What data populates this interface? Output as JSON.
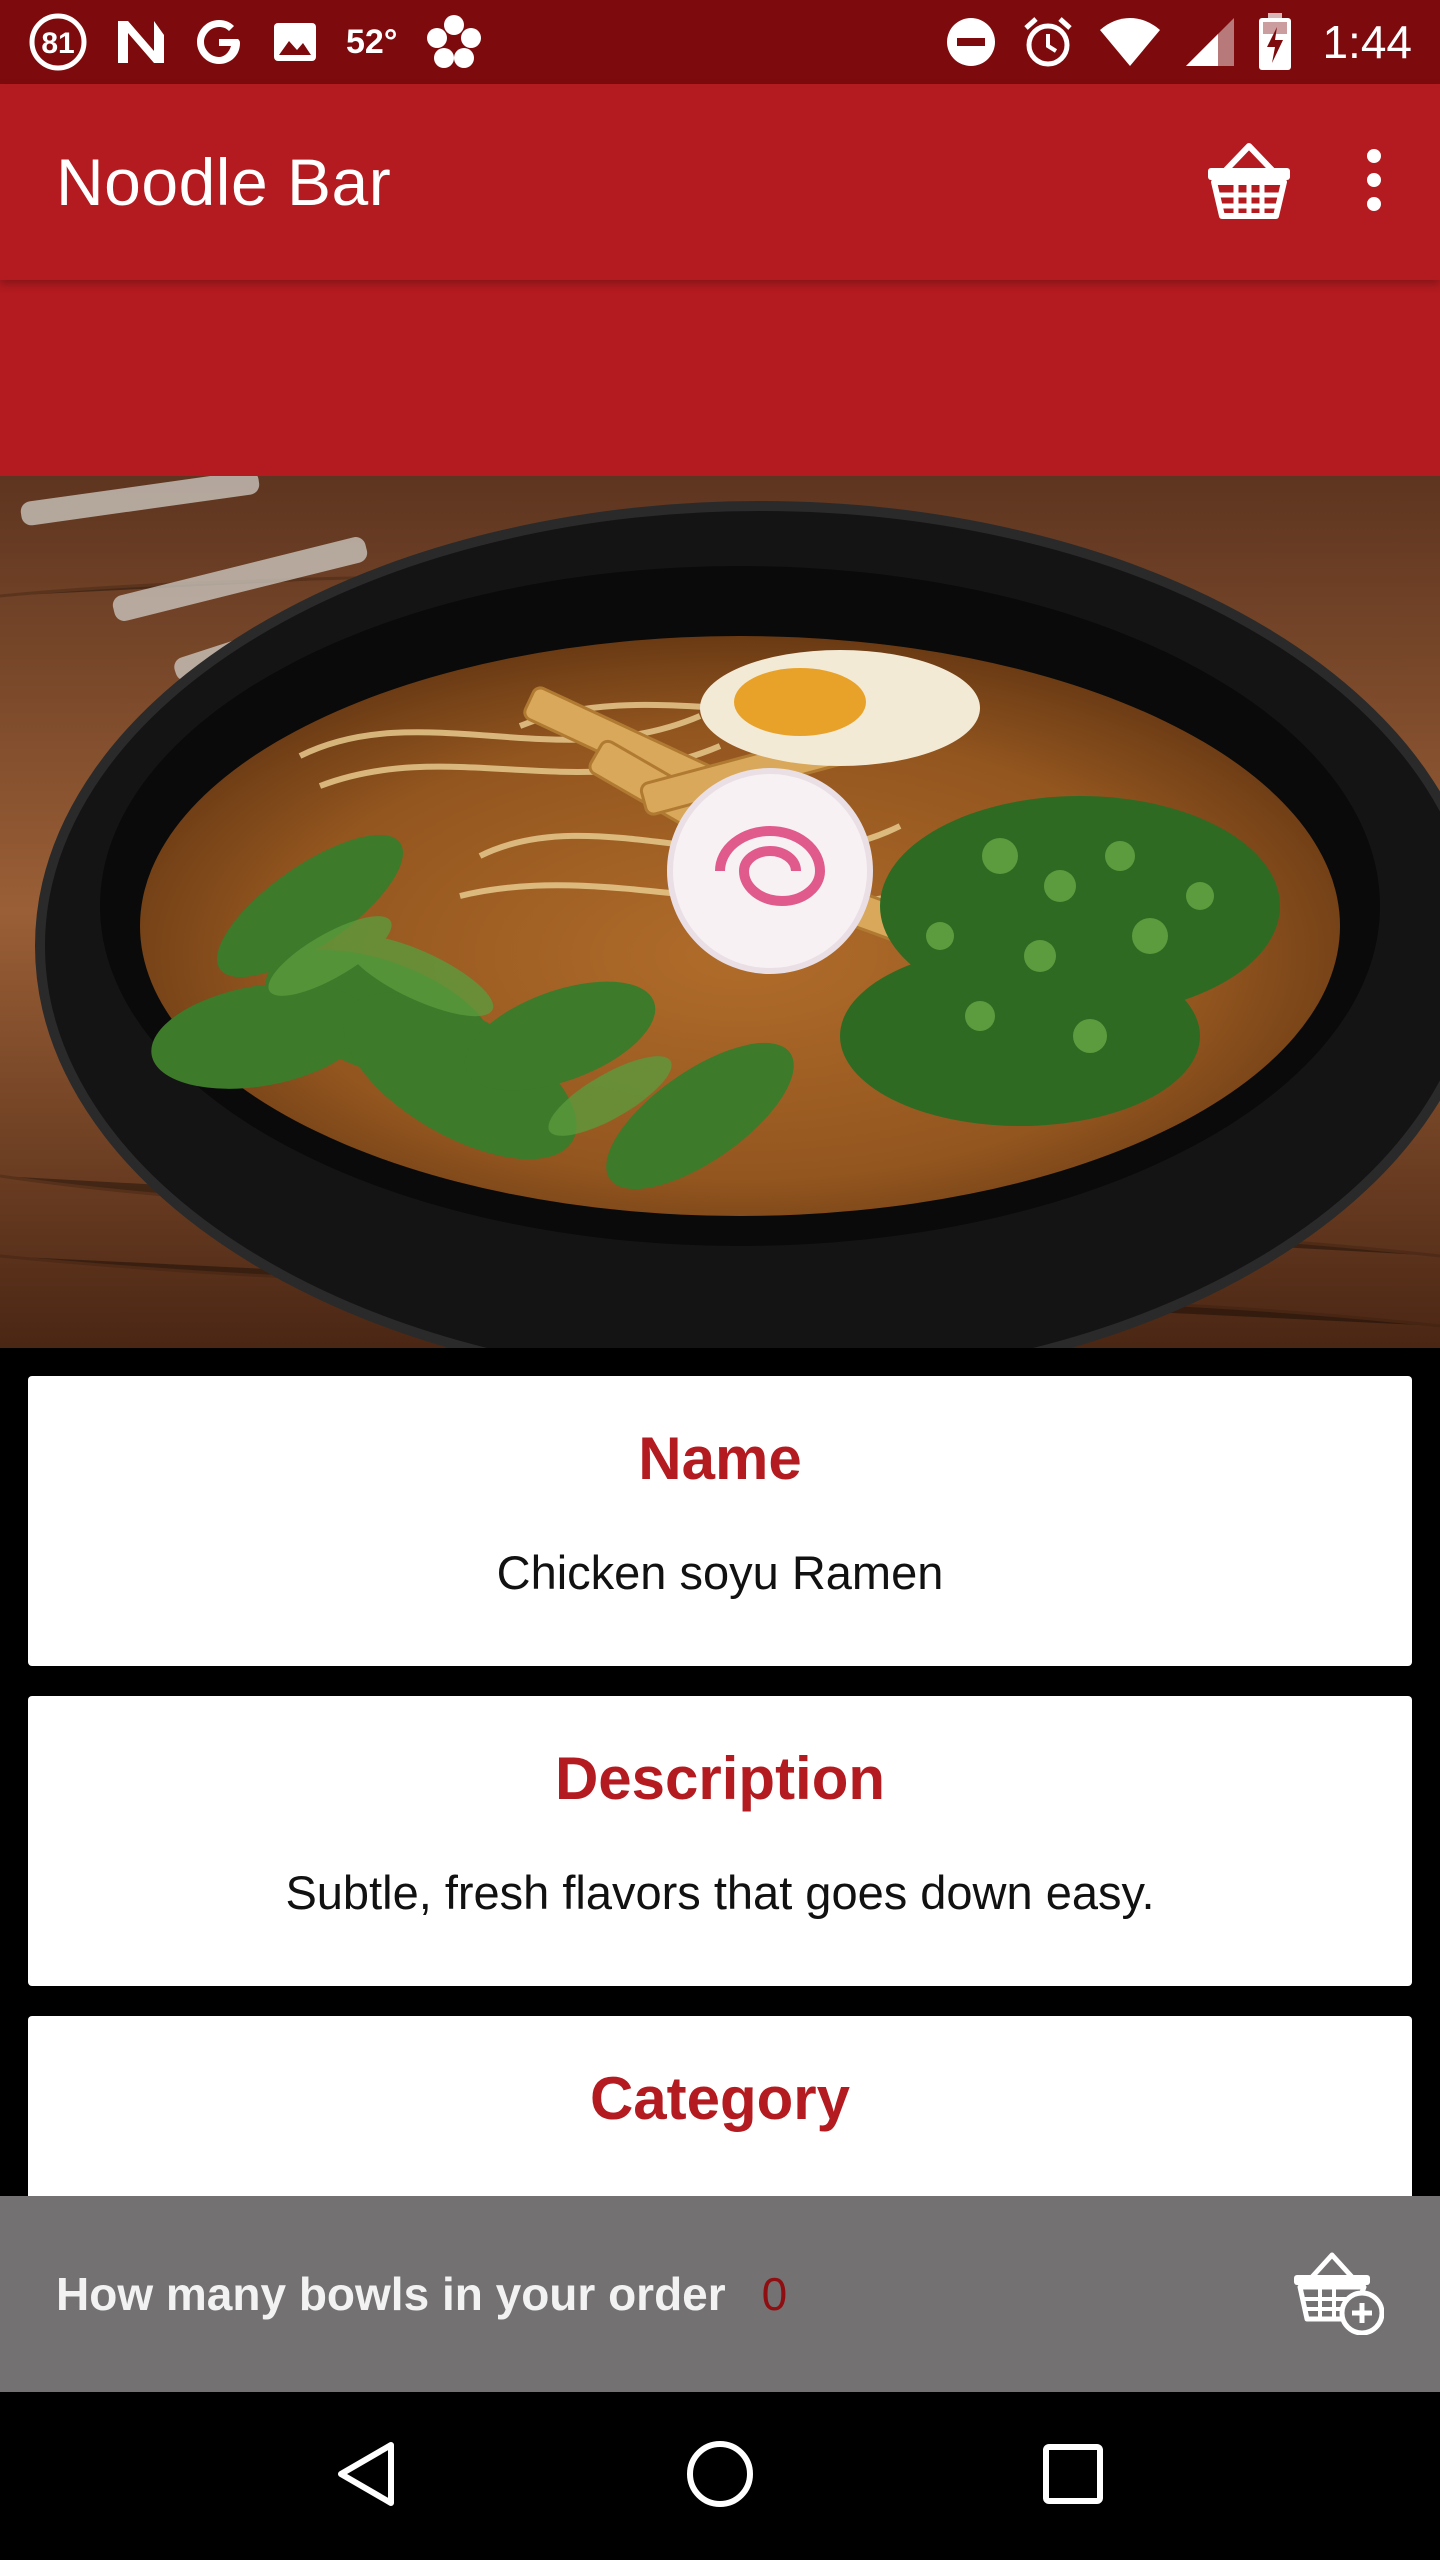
{
  "status_bar": {
    "notification_count": "81",
    "temperature": "52°",
    "clock": "1:44"
  },
  "app_bar": {
    "title": "Noodle Bar"
  },
  "details": {
    "name": {
      "title": "Name",
      "value": "Chicken soyu Ramen"
    },
    "description": {
      "title": "Description",
      "value": "Subtle, fresh flavors that goes down easy."
    },
    "category": {
      "title": "Category"
    }
  },
  "order_bar": {
    "label": "How many bowls in your order",
    "count": "0"
  },
  "colors": {
    "primary": "#b31b20",
    "primary_dark": "#7d0b0d",
    "order_bar_bg": "#737171",
    "count_color": "#8e0e12"
  },
  "icons": {
    "status_bar": [
      "notification-count-icon",
      "n-logo-icon",
      "google-icon",
      "image-icon",
      "flower-icon",
      "do-not-disturb-icon",
      "alarm-icon",
      "wifi-icon",
      "signal-icon",
      "battery-charging-icon"
    ],
    "app_bar": [
      "basket-icon",
      "overflow-menu-icon"
    ],
    "order_bar": [
      "add-to-basket-icon"
    ],
    "nav_bar": [
      "back-icon",
      "home-icon",
      "recents-icon"
    ]
  }
}
